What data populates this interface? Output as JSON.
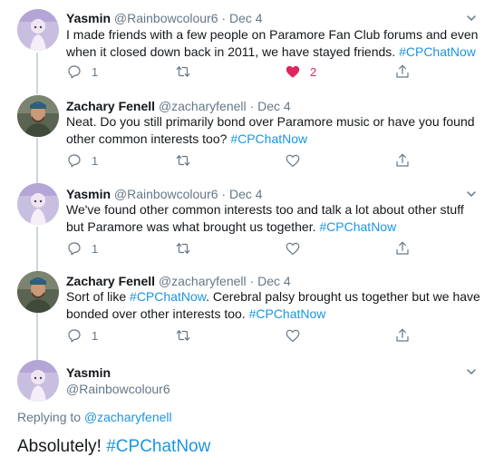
{
  "tweets": [
    {
      "name": "Yasmin",
      "handle": "@Rainbowcolour6",
      "sep": " · ",
      "date": "Dec 4",
      "text": "I made friends with a few people on Paramore Fan Club forums and even when it closed down back in 2011, we have stayed friends. ",
      "hashtag": "#CPChatNow",
      "reply_count": "1",
      "like_count": "2"
    },
    {
      "name": "Zachary Fenell",
      "handle": "@zacharyfenell",
      "sep": " · ",
      "date": "Dec 4",
      "text": "Neat. Do you still primarily bond over Paramore music or have you found other common interests too? ",
      "hashtag": "#CPChatNow",
      "reply_count": "1"
    },
    {
      "name": "Yasmin",
      "handle": "@Rainbowcolour6",
      "sep": " · ",
      "date": "Dec 4",
      "text": "We've found other common interests too and talk a lot about other stuff but Paramore was what brought us together. ",
      "hashtag": "#CPChatNow",
      "reply_count": "1"
    },
    {
      "name": "Zachary Fenell",
      "handle": "@zacharyfenell",
      "sep": " · ",
      "date": "Dec 4",
      "text_a": "Sort of like ",
      "hashtag_a": "#CPChatNow",
      "text_b": ". Cerebral palsy brought us together but we have bonded over other interests too. ",
      "hashtag_b": "#CPChatNow",
      "reply_count": "1"
    }
  ],
  "focused": {
    "name": "Yasmin",
    "handle": "@Rainbowcolour6",
    "replying_label": "Replying to ",
    "replying_handle": "@zacharyfenell",
    "text": "Absolutely! ",
    "hashtag": "#CPChatNow"
  },
  "icons": {
    "reply": "reply-icon",
    "retweet": "retweet-icon",
    "like": "heart-icon",
    "share": "share-icon",
    "more": "chevron-down-icon"
  },
  "colors": {
    "link": "#1b95e0",
    "like": "#e0245e",
    "secondary": "#657786"
  }
}
